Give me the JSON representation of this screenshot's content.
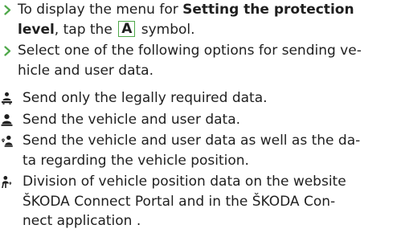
{
  "steps": [
    {
      "lines": [
        {
          "before": "To display the menu for ",
          "bold": "Setting the protection",
          "after": ""
        },
        {
          "bold": "level",
          "middle": ", tap the ",
          "symbol": "A",
          "after": " symbol."
        }
      ]
    },
    {
      "lines": [
        "Select one of the following options for sending ve-",
        "hicle and user data."
      ]
    }
  ],
  "options": [
    {
      "icon": "privacy-shield-person-icon",
      "lines": [
        "Send only the legally required data."
      ]
    },
    {
      "icon": "person-icon",
      "lines": [
        "Send the vehicle and user data."
      ]
    },
    {
      "icon": "location-person-icon",
      "lines": [
        "Send the vehicle and user data as well as the da-",
        "ta regarding the vehicle position."
      ]
    },
    {
      "icon": "shared-position-icon",
      "lines": [
        "Division of vehicle position data on the website",
        "ŠKODA Connect Portal and in the ŠKODA Con-",
        "nect application ."
      ]
    }
  ],
  "colors": {
    "accent": "#4fa84a",
    "text": "#1f1f1f"
  }
}
